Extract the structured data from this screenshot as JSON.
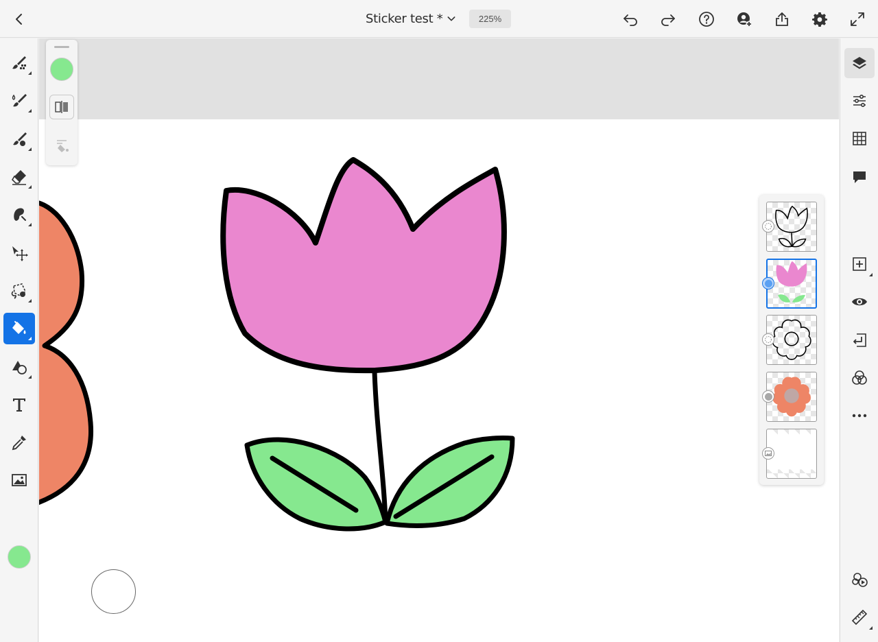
{
  "header": {
    "back_icon": "chevron-left-icon",
    "title": "Sticker test *",
    "title_menu_icon": "chevron-down-icon",
    "zoom": "225%",
    "actions": [
      "undo-icon",
      "redo-icon",
      "help-icon",
      "invite-icon",
      "share-icon",
      "settings-icon",
      "fullscreen-icon"
    ]
  },
  "left_toolbar": {
    "tools": [
      "pixel-brush-icon",
      "live-brush-icon",
      "vector-brush-icon",
      "eraser-icon",
      "smudge-icon",
      "transform-icon",
      "lasso-select-icon",
      "fill-icon",
      "shapes-icon",
      "text-icon",
      "eyedropper-icon",
      "image-icon"
    ],
    "active_tool": "fill-icon",
    "current_color": "#86e88f"
  },
  "brush_panel": {
    "color": "#86e88f",
    "tools": [
      "split-fill-icon",
      "fill-settings-icon"
    ]
  },
  "right_toolbar": {
    "top_tools": [
      "layers-icon",
      "layer-properties-icon",
      "grid-icon",
      "comments-icon"
    ],
    "layer_actions": [
      "add-layer-icon",
      "visibility-icon",
      "merge-down-icon",
      "blend-mode-icon",
      "more-icon"
    ],
    "bottom_tools": [
      "reference-layer-icon",
      "ruler-icon"
    ]
  },
  "layers": [
    {
      "name": "tulip-outline",
      "selected": false
    },
    {
      "name": "tulip-color",
      "selected": true
    },
    {
      "name": "flower-outline",
      "selected": false
    },
    {
      "name": "flower-color",
      "selected": false
    },
    {
      "name": "background-image",
      "selected": false
    }
  ],
  "colors": {
    "accent": "#1473e6",
    "tulip_pink": "#ea87cf",
    "leaf_green": "#86e88f",
    "flower_orange": "#ee8566",
    "flower_center": "#bfa7a5"
  }
}
